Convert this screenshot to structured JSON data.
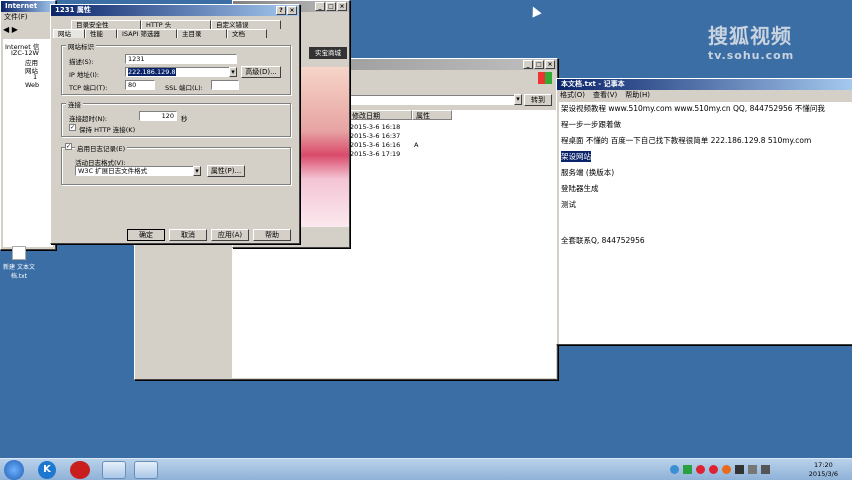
{
  "watermark": {
    "brand": "搜狐视频",
    "url": "tv.sohu.com"
  },
  "iis": {
    "title": "Internet",
    "menu": [
      "文件(F)"
    ],
    "tree": [
      "Internet 信",
      "IZC-12W",
      "应用",
      "网站",
      "1",
      "Web"
    ]
  },
  "adwin": {
    "tab_label": "实宝商城"
  },
  "explorer": {
    "go_label": "转到",
    "columns": [
      "修改日期",
      "属性"
    ],
    "rows": [
      {
        "date": "2015-3-6 16:18",
        "attr": ""
      },
      {
        "date": "2015-3-6 16:37",
        "attr": ""
      },
      {
        "date": "2015-3-6 16:16",
        "attr": "A"
      },
      {
        "date": "2015-3-6 17:19",
        "attr": ""
      }
    ]
  },
  "notepad": {
    "title": "本文档.txt - 记事本",
    "menu": [
      "格式(O)",
      "查看(V)",
      "帮助(H)"
    ],
    "lines": [
      "架设视频教程 www.510my.com www.510my.cn QQ, 844752956 不懂问我",
      "程一步一步跟着做",
      "程桌面 不懂的 百度一下自己找下教程很简单 222.186.129.8 510my.com",
      "架设网站",
      "服务端 (换版本)",
      "登陆器生成",
      "测试",
      "",
      "全套联系Q, 844752956"
    ],
    "selected_line_index": 3
  },
  "props": {
    "title": "1231 属性",
    "help_btn": "?",
    "tabs_top": [
      "目录安全性",
      "HTTP 头",
      "自定义错误"
    ],
    "tabs_bottom": [
      "网站",
      "性能",
      "ISAPI 筛选器",
      "主目录",
      "文档"
    ],
    "group_identity": "网站标识",
    "desc_label": "描述(S):",
    "desc_value": "1231",
    "ip_label": "IP 地址(I):",
    "ip_value": "222.186.129.8",
    "advanced_btn": "高级(D)...",
    "tcp_label": "TCP 端口(T):",
    "tcp_value": "80",
    "ssl_label": "SSL 端口(L):",
    "ssl_value": "",
    "group_conn": "连接",
    "timeout_label": "连接超时(N):",
    "timeout_value": "120",
    "timeout_unit": "秒",
    "keepalive_label": "保持 HTTP 连接(K)",
    "keepalive_checked": true,
    "log_label": "启用日志记录(E)",
    "log_checked": true,
    "log_format_label": "活动日志格式(V):",
    "log_format_value": "W3C 扩展日志文件格式",
    "log_props_btn": "属性(P)...",
    "ok": "确定",
    "cancel": "取消",
    "apply": "应用(A)",
    "help": "帮助"
  },
  "desktop_icon": {
    "label": "新建 文本文档.txt"
  },
  "taskbar": {
    "time": "17:20",
    "date": "2015/3/6"
  }
}
